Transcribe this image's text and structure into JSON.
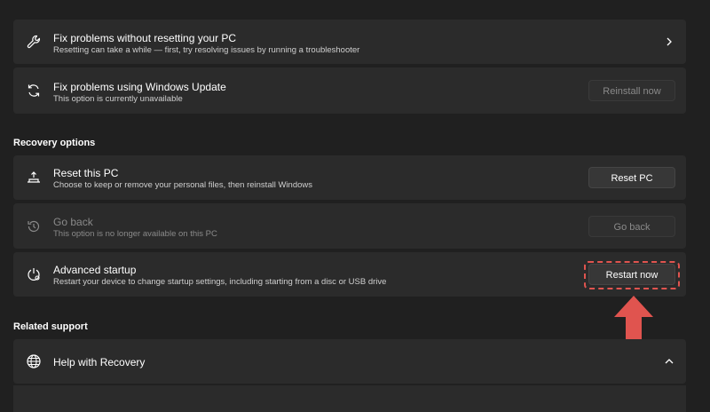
{
  "fix_troubleshooter": {
    "title": "Fix problems without resetting your PC",
    "subtitle": "Resetting can take a while — first, try resolving issues by running a troubleshooter",
    "icon": "wrench-icon"
  },
  "fix_update": {
    "title": "Fix problems using Windows Update",
    "subtitle": "This option is currently unavailable",
    "button": "Reinstall now",
    "icon": "sync-icon"
  },
  "recovery_options": {
    "heading": "Recovery options",
    "reset": {
      "title": "Reset this PC",
      "subtitle": "Choose to keep or remove your personal files, then reinstall Windows",
      "button": "Reset PC",
      "icon": "reset-pc-icon"
    },
    "go_back": {
      "title": "Go back",
      "subtitle": "This option is no longer available on this PC",
      "button": "Go back",
      "icon": "history-icon"
    },
    "advanced": {
      "title": "Advanced startup",
      "subtitle": "Restart your device to change startup settings, including starting from a disc or USB drive",
      "button": "Restart now",
      "icon": "advanced-startup-icon"
    }
  },
  "related_support": {
    "heading": "Related support",
    "help": {
      "title": "Help with Recovery",
      "icon": "globe-icon"
    }
  },
  "colors": {
    "background": "#202020",
    "card": "#2b2b2b",
    "annotation": "#e0544f"
  }
}
